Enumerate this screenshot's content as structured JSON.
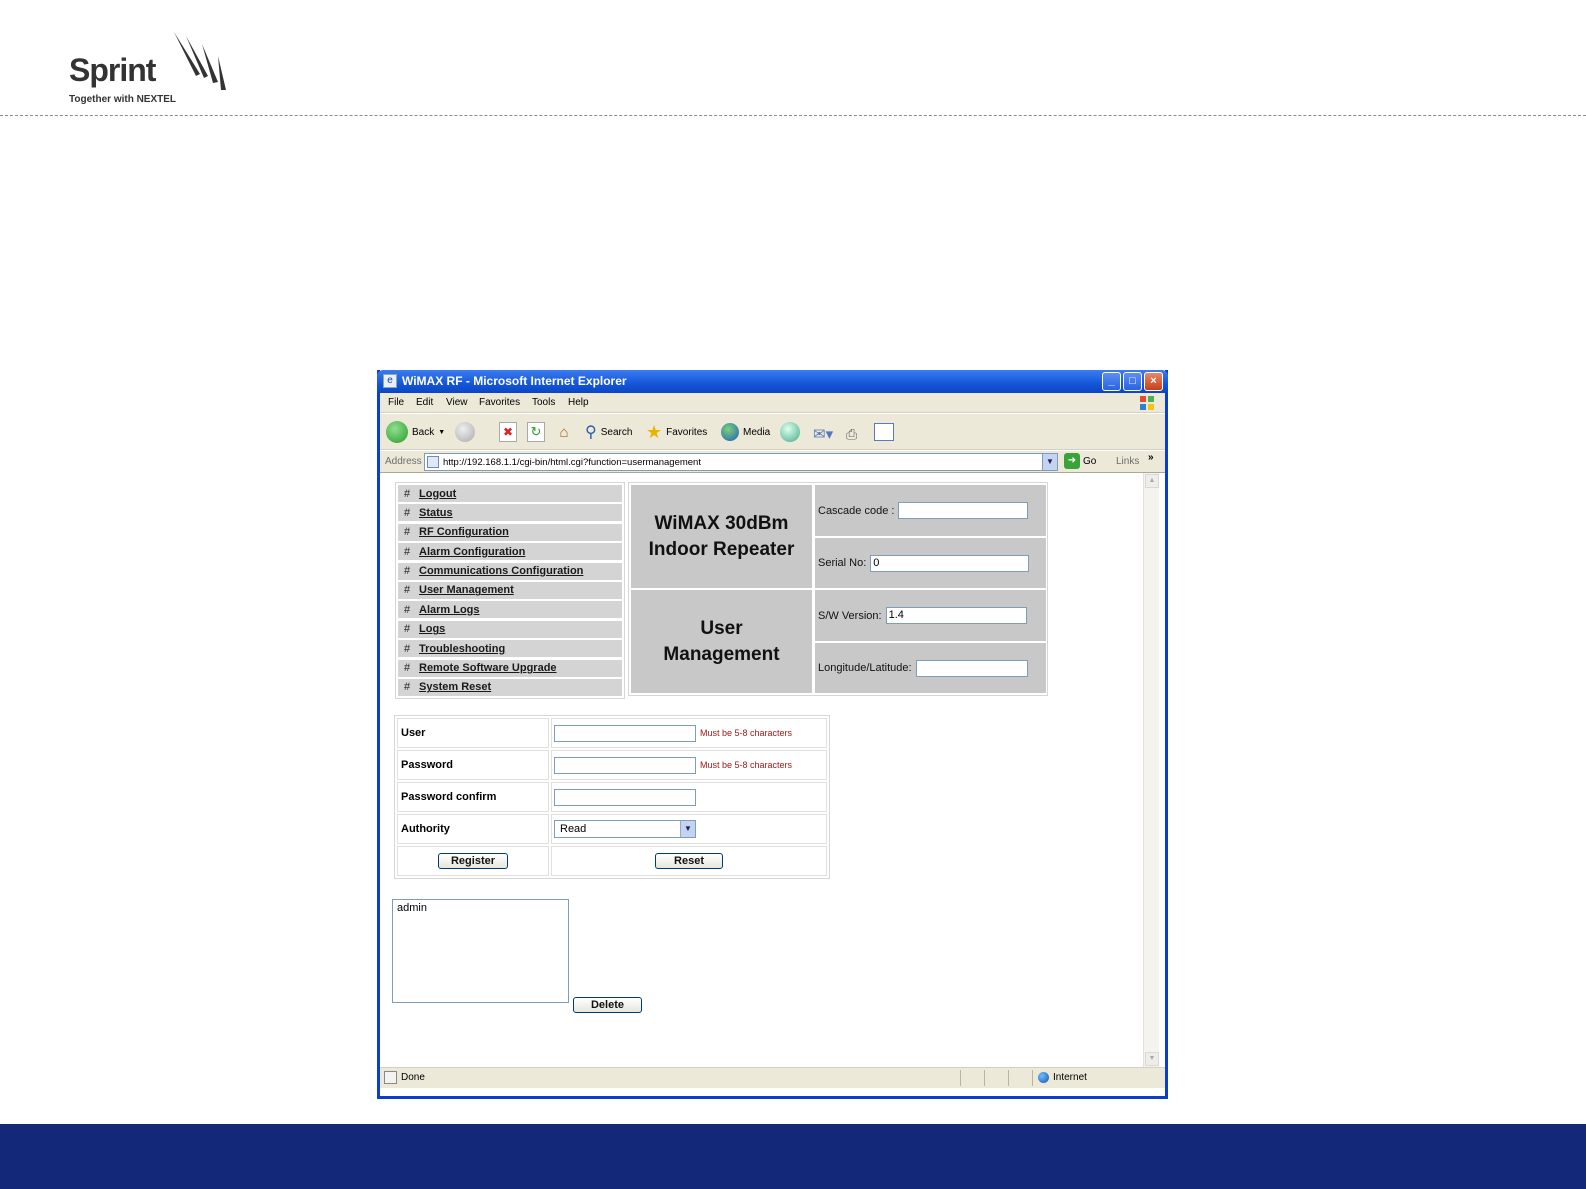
{
  "slide": {
    "logo_word": "Sprint",
    "logo_tagline": "Together with NEXTEL",
    "footer_color": "#14287a"
  },
  "window": {
    "title": "WiMAX RF - Microsoft Internet Explorer",
    "controls": {
      "minimize": "_",
      "maximize": "□",
      "close": "×"
    }
  },
  "menubar": [
    "File",
    "Edit",
    "View",
    "Favorites",
    "Tools",
    "Help"
  ],
  "toolbar": {
    "back": "Back",
    "search": "Search",
    "favorites": "Favorites",
    "media": "Media"
  },
  "address": {
    "label": "Address",
    "url": "http://192.168.1.1/cgi-bin/html.cgi?function=usermanagement",
    "go": "Go",
    "links": "Links",
    "more": "»"
  },
  "nav": {
    "bullet": "#",
    "items": [
      "Logout",
      "Status",
      "RF Configuration",
      "Alarm Configuration",
      "Communications Configuration",
      "User Management",
      "Alarm Logs",
      "Logs",
      "Troubleshooting",
      "Remote Software Upgrade",
      "System Reset"
    ]
  },
  "header": {
    "product_line1": "WiMAX 30dBm",
    "product_line2": "Indoor Repeater",
    "page_line1": "User",
    "page_line2": "Management",
    "cascade_label": "Cascade code :",
    "cascade_value": "",
    "serial_label": "Serial No:",
    "serial_value": "0",
    "sw_label": "S/W Version:",
    "sw_value": "1.4",
    "lonlat_label": "Longitude/Latitude:",
    "lonlat_value": ""
  },
  "form": {
    "user_label": "User",
    "user_hint": "Must be 5-8 characters",
    "password_label": "Password",
    "password_hint": "Must be 5-8 characters",
    "confirm_label": "Password confirm",
    "authority_label": "Authority",
    "authority_value": "Read",
    "register": "Register",
    "reset": "Reset"
  },
  "users": {
    "list": [
      "admin"
    ],
    "delete": "Delete"
  },
  "status": {
    "text": "Done",
    "zone": "Internet"
  }
}
